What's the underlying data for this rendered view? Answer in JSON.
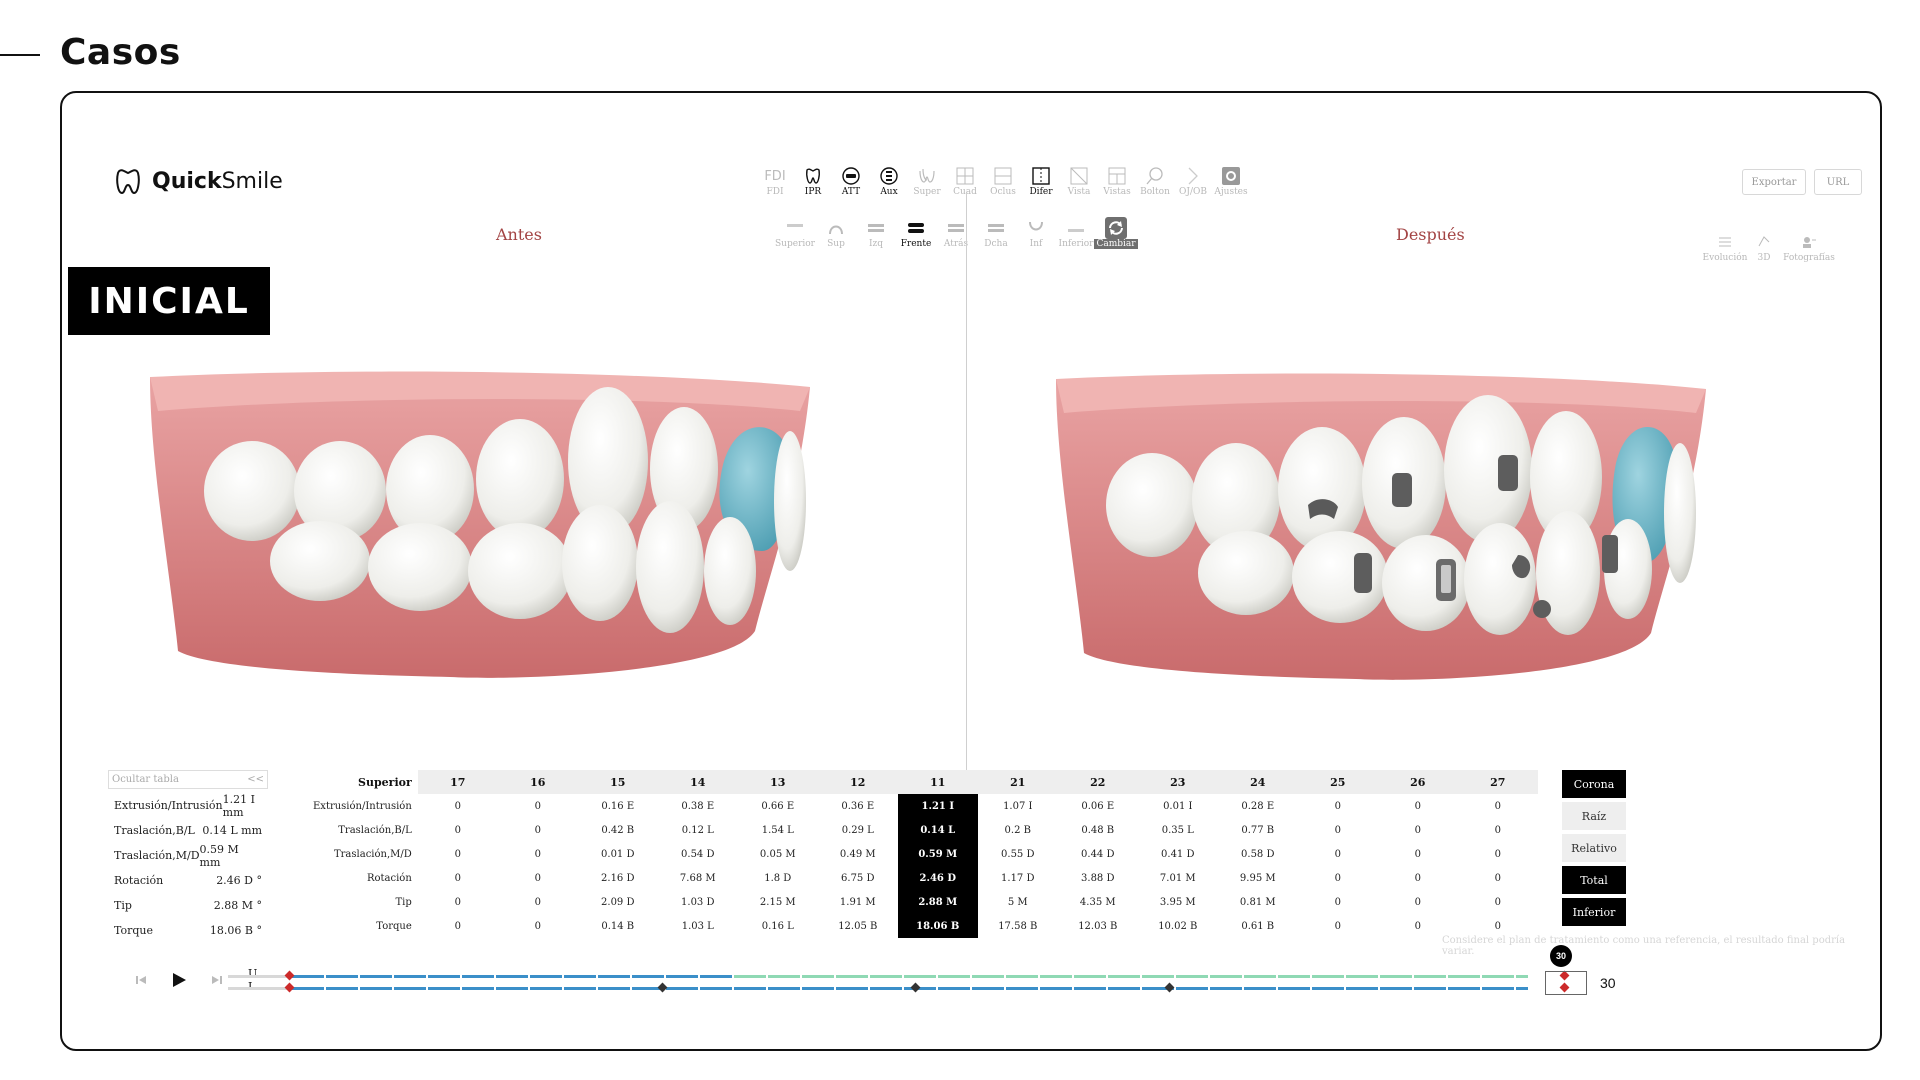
{
  "page": {
    "title": "Casos"
  },
  "logo": {
    "brand_bold": "Quick",
    "brand_light": "Smile"
  },
  "toolbar_top": [
    {
      "label": "FDI",
      "icon": "fdi-icon",
      "active": false
    },
    {
      "label": "IPR",
      "icon": "tooth-ipr-icon",
      "active": true
    },
    {
      "label": "ATT",
      "icon": "attachment-icon",
      "active": true
    },
    {
      "label": "Aux",
      "icon": "aux-icon",
      "active": true
    },
    {
      "label": "Super",
      "icon": "superimpose-icon",
      "active": false
    },
    {
      "label": "Cuad",
      "icon": "grid-icon",
      "active": false
    },
    {
      "label": "Oclus",
      "icon": "occlusion-icon",
      "active": false
    },
    {
      "label": "Difer",
      "icon": "difference-icon",
      "active": true
    },
    {
      "label": "Vista",
      "icon": "view-icon",
      "active": false
    },
    {
      "label": "Vistas",
      "icon": "views-icon",
      "active": false
    },
    {
      "label": "Bolton",
      "icon": "bolton-icon",
      "active": false
    },
    {
      "label": "OJ/OB",
      "icon": "ojob-icon",
      "active": false
    },
    {
      "label": "Ajustes",
      "icon": "settings-icon",
      "active": false
    }
  ],
  "toolbar_views": [
    {
      "label": "Superior",
      "icon": "upper-arch-icon",
      "state": "off"
    },
    {
      "label": "Sup",
      "icon": "arch-sup-icon",
      "state": "off"
    },
    {
      "label": "Izq",
      "icon": "left-view-icon",
      "state": "off"
    },
    {
      "label": "Frente",
      "icon": "front-view-icon",
      "state": "on"
    },
    {
      "label": "Atrás",
      "icon": "back-view-icon",
      "state": "off"
    },
    {
      "label": "Dcha",
      "icon": "right-view-icon",
      "state": "off"
    },
    {
      "label": "Inf",
      "icon": "arch-inf-icon",
      "state": "off"
    },
    {
      "label": "Inferior",
      "icon": "lower-arch-icon",
      "state": "off"
    },
    {
      "label": "Cambiar",
      "icon": "swap-icon",
      "state": "selected"
    }
  ],
  "right_buttons": {
    "export": "Exportar",
    "url": "URL"
  },
  "right_tools": [
    {
      "label": "Evolución",
      "icon": "evolution-icon"
    },
    {
      "label": "3D",
      "icon": "3d-icon"
    },
    {
      "label": "Fotografías",
      "icon": "photos-icon"
    }
  ],
  "views": {
    "before": "Antes",
    "after": "Después"
  },
  "badge": "INICIAL",
  "side_panel": {
    "hide_label": "Ocultar tabla",
    "collapse": "<<",
    "rows": [
      {
        "label": "Extrusión/Intrusión",
        "value": "1.21 I mm"
      },
      {
        "label": "Traslación,B/L",
        "value": "0.14 L mm"
      },
      {
        "label": "Traslación,M/D",
        "value": "0.59 M mm"
      },
      {
        "label": "Rotación",
        "value": "2.46 D °"
      },
      {
        "label": "Tip",
        "value": "2.88 M °"
      },
      {
        "label": "Torque",
        "value": "18.06 B °"
      }
    ]
  },
  "table": {
    "row_header": "Superior",
    "teeth": [
      "17",
      "16",
      "15",
      "14",
      "13",
      "12",
      "11",
      "21",
      "22",
      "23",
      "24",
      "25",
      "26",
      "27"
    ],
    "selected_col": 6,
    "rows": [
      {
        "label": "Extrusión/Intrusión",
        "cells": [
          "0",
          "0",
          "0.16 E",
          "0.38 E",
          "0.66 E",
          "0.36 E",
          "1.21 I",
          "1.07 I",
          "0.06 E",
          "0.01 I",
          "0.28 E",
          "0",
          "0",
          "0"
        ]
      },
      {
        "label": "Traslación,B/L",
        "cells": [
          "0",
          "0",
          "0.42 B",
          "0.12 L",
          "1.54 L",
          "0.29 L",
          "0.14 L",
          "0.2 B",
          "0.48 B",
          "0.35 L",
          "0.77 B",
          "0",
          "0",
          "0"
        ]
      },
      {
        "label": "Traslación,M/D",
        "cells": [
          "0",
          "0",
          "0.01 D",
          "0.54 D",
          "0.05 M",
          "0.49 M",
          "0.59 M",
          "0.55 D",
          "0.44 D",
          "0.41 D",
          "0.58 D",
          "0",
          "0",
          "0"
        ]
      },
      {
        "label": "Rotación",
        "cells": [
          "0",
          "0",
          "2.16 D",
          "7.68 M",
          "1.8 D",
          "6.75 D",
          "2.46 D",
          "1.17 D",
          "3.88 D",
          "7.01 M",
          "9.95 M",
          "0",
          "0",
          "0"
        ]
      },
      {
        "label": "Tip",
        "cells": [
          "0",
          "0",
          "2.09 D",
          "1.03 D",
          "2.15 M",
          "1.91 M",
          "2.88 M",
          "5 M",
          "4.35 M",
          "3.95 M",
          "0.81 M",
          "0",
          "0",
          "0"
        ]
      },
      {
        "label": "Torque",
        "cells": [
          "0",
          "0",
          "0.14 B",
          "1.03 L",
          "0.16 L",
          "12.05 B",
          "18.06 B",
          "17.58 B",
          "12.03 B",
          "10.02 B",
          "0.61 B",
          "0",
          "0",
          "0"
        ]
      }
    ]
  },
  "modes": [
    {
      "label": "Corona",
      "on": true
    },
    {
      "label": "Raíz",
      "on": false
    },
    {
      "label": "Relativo",
      "on": false
    },
    {
      "label": "Total",
      "on": true
    },
    {
      "label": "Inferior",
      "on": true
    }
  ],
  "note": "Considere el plan de tratamiento como una referencia, el resultado final podría variar.",
  "timeline": {
    "upper_label": "U",
    "lower_label": "L",
    "current_step": "30",
    "total_steps": "30",
    "colors": {
      "blue": "#3b8fc9",
      "green": "#8fd9b4",
      "red": "#cc2a2a"
    }
  }
}
